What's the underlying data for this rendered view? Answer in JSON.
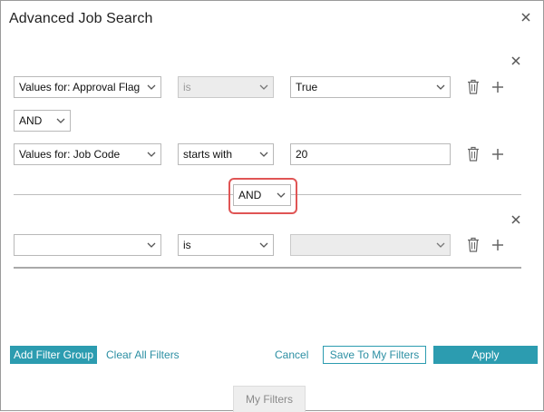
{
  "dialog": {
    "title": "Advanced Job Search"
  },
  "group1": {
    "row1": {
      "field": "Values for:  Approval Flag",
      "operator": "is",
      "value": "True"
    },
    "connector": "AND",
    "row2": {
      "field": "Values for:  Job Code",
      "operator": "starts with",
      "value": "20"
    }
  },
  "group_connector": "AND",
  "group2": {
    "row1": {
      "field": "",
      "operator": "is",
      "value": ""
    }
  },
  "footer": {
    "add_filter_group": "Add Filter Group",
    "clear_all_filters": "Clear All Filters",
    "cancel": "Cancel",
    "save_to_my_filters": "Save To My Filters",
    "apply": "Apply"
  },
  "tabs": {
    "my_filters": "My Filters"
  },
  "colors": {
    "accent": "#2c9cb0",
    "highlight": "#e05555"
  }
}
